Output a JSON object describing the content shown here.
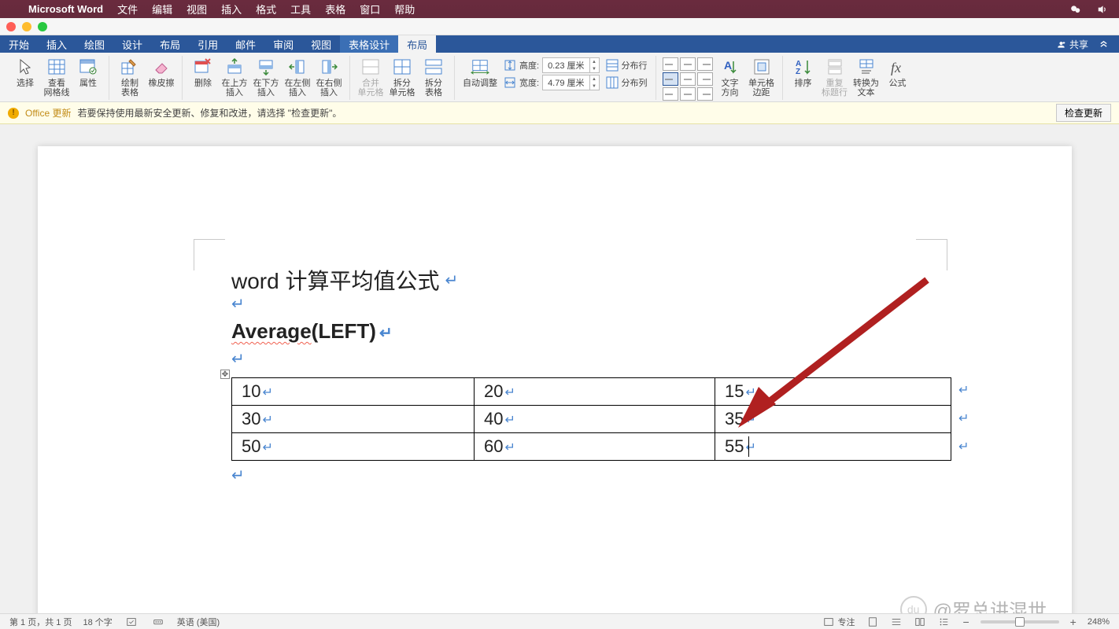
{
  "mac_menubar": {
    "app": "Microsoft Word",
    "items": [
      "文件",
      "编辑",
      "视图",
      "插入",
      "格式",
      "工具",
      "表格",
      "窗口",
      "帮助"
    ]
  },
  "tabs": {
    "items": [
      "开始",
      "插入",
      "绘图",
      "设计",
      "布局",
      "引用",
      "邮件",
      "审阅",
      "视图"
    ],
    "context_group": "表格设计",
    "context_active": "布局",
    "share": "共享"
  },
  "ribbon": {
    "select": "选择",
    "gridlines": "查看\n网格线",
    "properties": "属性",
    "draw_table": "绘制\n表格",
    "eraser": "橡皮擦",
    "delete": "删除",
    "ins_above": "在上方\n插入",
    "ins_below": "在下方\n插入",
    "ins_left": "在左侧\n插入",
    "ins_right": "在右侧\n插入",
    "merge": "合并\n单元格",
    "split_cells": "拆分\n单元格",
    "split_table": "拆分\n表格",
    "autofit": "自动调整",
    "height_label": "高度:",
    "height_value": "0.23 厘米",
    "width_label": "宽度:",
    "width_value": "4.79 厘米",
    "dist_rows": "分布行",
    "dist_cols": "分布列",
    "text_dir": "文字\n方向",
    "cell_margin": "单元格\n边距",
    "sort": "排序",
    "repeat_hdr": "重复\n标题行",
    "to_text": "转换为\n文本",
    "formula": "公式"
  },
  "banner": {
    "title": "Office 更新",
    "msg": "若要保持使用最新安全更新、修复和改进，请选择 \"检查更新\"。",
    "button": "检查更新"
  },
  "document": {
    "heading": "word 计算平均值公式",
    "avg_left": "Average",
    "avg_right": "(LEFT)",
    "table": [
      [
        "10",
        "20",
        "15"
      ],
      [
        "30",
        "40",
        "35"
      ],
      [
        "50",
        "60",
        "55"
      ]
    ]
  },
  "watermark": {
    "logo": "du",
    "text": "@罗总讲混世"
  },
  "status": {
    "page": "第 1 页，共 1 页",
    "words": "18 个字",
    "lang": "英语 (美国)",
    "focus": "专注",
    "zoom": "248%"
  }
}
